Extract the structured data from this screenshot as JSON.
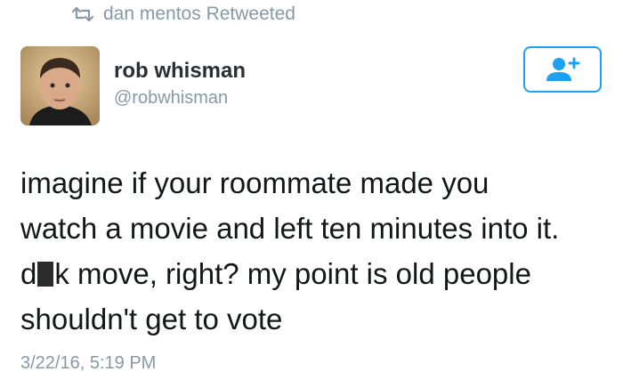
{
  "retweet": {
    "icon": "retweet-icon",
    "label": "dan mentos Retweeted"
  },
  "author": {
    "name": "rob whisman",
    "handle": "@robwhisman",
    "avatar": "avatar"
  },
  "follow_button": {
    "icon": "add-user-icon",
    "accent": "#1da1f2"
  },
  "tweet": {
    "line1": "imagine if your roommate made you",
    "line2": "watch a movie and left ten minutes into it.",
    "line3_start": "d",
    "line3_end": "k move, right? my point is old people",
    "line4": "shouldn't get to vote"
  },
  "timestamp": "3/22/16, 5:19 PM",
  "colors": {
    "muted": "#8899a6",
    "text": "#14171a",
    "accent": "#1da1f2"
  }
}
